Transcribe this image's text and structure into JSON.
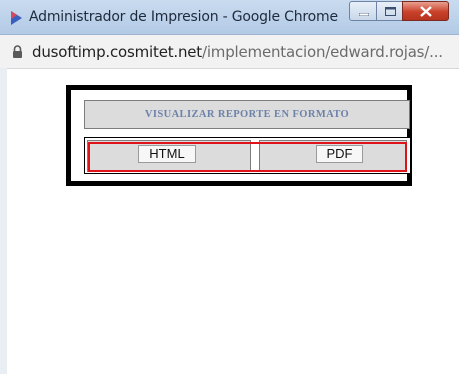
{
  "window": {
    "title": "Administrador de Impresion - Google Chrome",
    "controls": {
      "minimize": "minimize-icon",
      "maximize": "maximize-icon",
      "close": "close-icon"
    }
  },
  "address_bar": {
    "url_host": "dusoftimp.cosmitet.net",
    "url_path": "/implementacion/edward.rojas/...",
    "security_icon": "lock-icon"
  },
  "report_format": {
    "heading": "VISUALIZAR REPORTE EN FORMATO",
    "options": [
      {
        "label": "HTML"
      },
      {
        "label": "PDF"
      }
    ]
  },
  "colors": {
    "heading_text": "#6d82a9",
    "highlight_frame": "#e0131b",
    "box_border": "#000000",
    "cell_fill": "#dcdcdc"
  }
}
